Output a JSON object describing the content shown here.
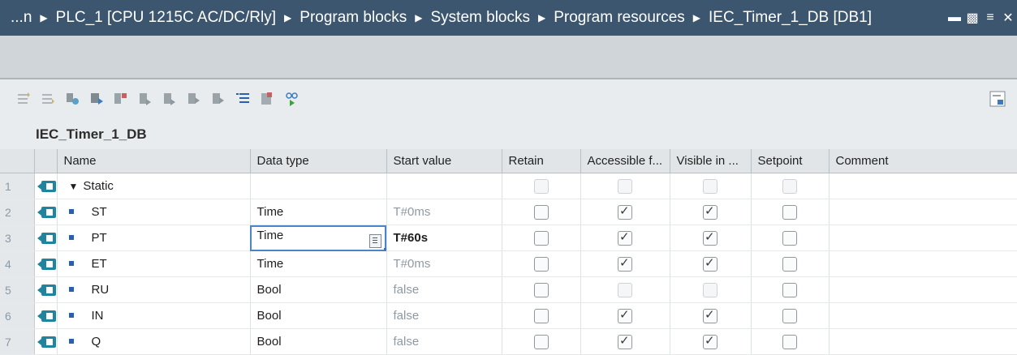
{
  "breadcrumb": [
    "...n",
    "PLC_1 [CPU 1215C AC/DC/Rly]",
    "Program blocks",
    "System blocks",
    "Program resources",
    "IEC_Timer_1_DB [DB1]"
  ],
  "block_title": "IEC_Timer_1_DB",
  "columns": [
    "Name",
    "Data type",
    "Start value",
    "Retain",
    "Accessible f...",
    "Visible in ...",
    "Setpoint",
    "Comment"
  ],
  "rows": [
    {
      "num": "1",
      "name": "Static",
      "type": "",
      "start": "",
      "retain": false,
      "accessible": false,
      "visible": false,
      "setpoint": false,
      "disabled": true
    },
    {
      "num": "2",
      "name": "ST",
      "type": "Time",
      "start": "T#0ms",
      "retain": false,
      "accessible": true,
      "visible": true,
      "setpoint": false
    },
    {
      "num": "3",
      "name": "PT",
      "type": "Time",
      "start": "T#60s",
      "retain": false,
      "accessible": true,
      "visible": true,
      "setpoint": false,
      "selected": true
    },
    {
      "num": "4",
      "name": "ET",
      "type": "Time",
      "start": "T#0ms",
      "retain": false,
      "accessible": true,
      "visible": true,
      "setpoint": false
    },
    {
      "num": "5",
      "name": "RU",
      "type": "Bool",
      "start": "false",
      "retain": false,
      "accessible": false,
      "visible": false,
      "setpoint": false
    },
    {
      "num": "6",
      "name": "IN",
      "type": "Bool",
      "start": "false",
      "retain": false,
      "accessible": true,
      "visible": true,
      "setpoint": false
    },
    {
      "num": "7",
      "name": "Q",
      "type": "Bool",
      "start": "false",
      "retain": false,
      "accessible": true,
      "visible": true,
      "setpoint": false
    }
  ],
  "colors": {
    "titlebar": "#3c566f",
    "toolbar": "#e9ecee",
    "header": "#e1e5e8",
    "accent": "#1f84a0"
  }
}
